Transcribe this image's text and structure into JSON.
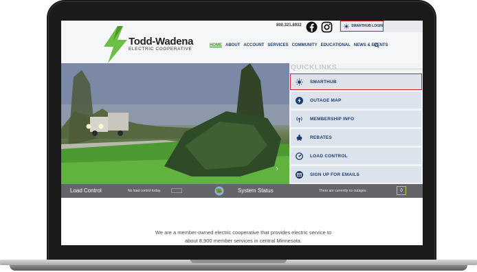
{
  "header": {
    "phone": "800.321.8932",
    "login_label": "SMARTHUB LOGIN",
    "logo_title": "Todd-Wadena",
    "logo_subtitle": "ELECTRIC COOPERATIVE"
  },
  "nav": {
    "items": [
      "HOME",
      "ABOUT",
      "ACCOUNT",
      "SERVICES",
      "COMMUNITY",
      "EDUCATIONAL",
      "NEWS & EVENTS"
    ]
  },
  "quicklinks": {
    "heading": "QUICKLINKS",
    "items": [
      {
        "label": "SMARTHUB",
        "icon": "sun-icon"
      },
      {
        "label": "OUTAGE MAP",
        "icon": "power-bolt-icon"
      },
      {
        "label": "MEMBERSHIP INFO",
        "icon": "broadcast-icon"
      },
      {
        "label": "REBATES",
        "icon": "piggy-bank-icon"
      },
      {
        "label": "LOAD CONTROL",
        "icon": "gauge-icon"
      },
      {
        "label": "SIGN UP FOR EMAILS",
        "icon": "email-icon"
      }
    ]
  },
  "status_bar": {
    "load_control_title": "Load Control",
    "load_control_text": "No load control today.",
    "load_control_pill": "",
    "system_status_title": "System Status",
    "outage_text": "There are currently no outages.",
    "outage_count": "0"
  },
  "mission": {
    "line1": "We are a member-owned electric cooperative that provides electric service to",
    "line2": "about 8,900 member services in central Minnesota."
  },
  "colors": {
    "brand_navy": "#1b3c6e",
    "brand_green": "#3a8a2a",
    "highlight_red": "#d32028",
    "status_bar": "#636569"
  }
}
